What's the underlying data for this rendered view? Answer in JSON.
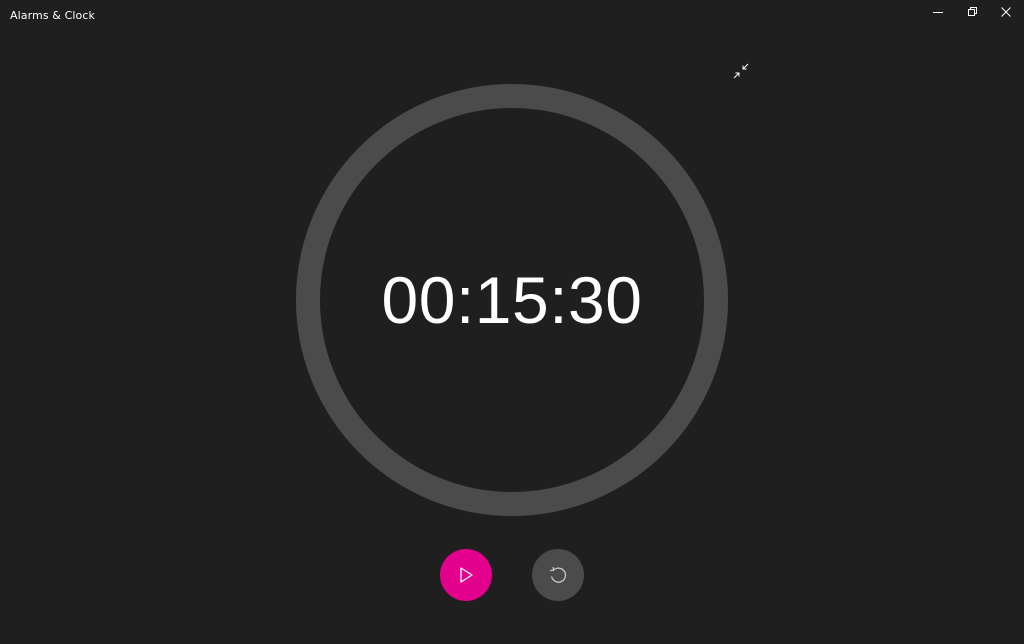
{
  "window": {
    "title": "Alarms & Clock"
  },
  "titlebar_buttons": {
    "minimize_icon": "minimize-icon",
    "restore_icon": "restore-icon",
    "close_icon": "close-icon"
  },
  "timer": {
    "time": "00:15:30",
    "ring_color": "#4b4b4b"
  },
  "controls": {
    "play_icon": "play-icon",
    "play_color": "#e3008c",
    "reset_icon": "reset-icon",
    "reset_color": "#4b4b4b",
    "compact_icon": "exit-compact-overlay-icon"
  },
  "theme": {
    "background": "#1f1f1f",
    "text": "#ffffff"
  }
}
